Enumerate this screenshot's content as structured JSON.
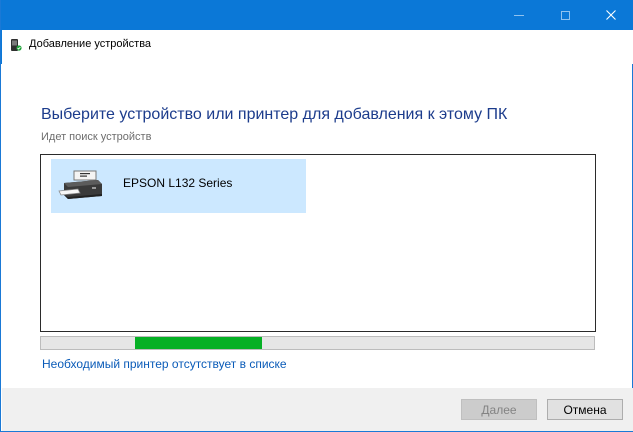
{
  "window": {
    "title": "Добавление устройства",
    "controls": {
      "minimize": "minimize-icon",
      "maximize": "maximize-icon",
      "close": "close-icon"
    }
  },
  "main": {
    "heading": "Выберите устройство или принтер для добавления к этому ПК",
    "status": "Идет поиск устройств",
    "devices": [
      {
        "name": "EPSON L132 Series",
        "icon": "printer-icon",
        "selected": true
      }
    ],
    "progress": {
      "fraction": 0.23,
      "style": "indeterminate-marquee"
    },
    "missing_printer_link": "Необходимый принтер отсутствует в списке"
  },
  "footer": {
    "next_label": "Далее",
    "next_enabled": false,
    "cancel_label": "Отмена"
  },
  "colors": {
    "titlebar": "#0b78d7",
    "heading": "#1c3c8c",
    "link": "#0a5bb8",
    "selection": "#cce8ff",
    "progress": "#06b025"
  }
}
